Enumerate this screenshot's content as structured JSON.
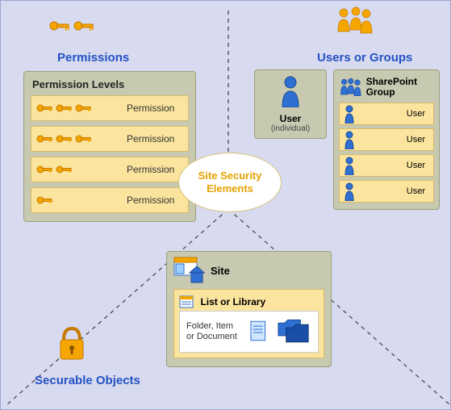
{
  "center": {
    "label": "Site Security Elements"
  },
  "permissions": {
    "title": "Permissions",
    "panel_title": "Permission Levels",
    "row_label": "Permission",
    "rows": [
      3,
      3,
      2,
      1
    ]
  },
  "users_groups": {
    "title": "Users or Groups",
    "user": {
      "title": "User",
      "subtitle": "(individual)"
    },
    "group": {
      "title": "SharePoint Group",
      "row_label": "User",
      "rows": 4
    }
  },
  "securable": {
    "title": "Securable Objects",
    "site_label": "Site",
    "library_label": "List or Library",
    "document_label": "Folder, Item or Document"
  }
}
